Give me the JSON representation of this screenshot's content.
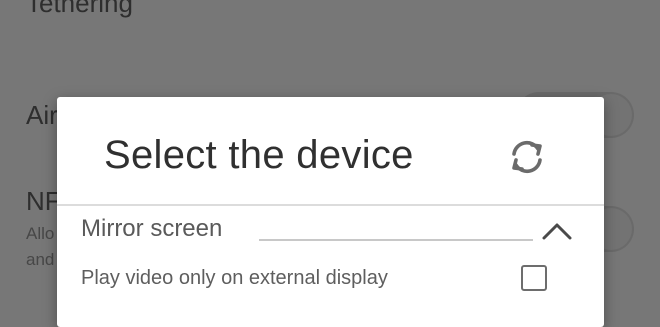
{
  "background": {
    "settings_items": [
      {
        "label": "Tethering"
      },
      {
        "label": "Air"
      },
      {
        "label": "NF",
        "subtitle_line1": "Allo",
        "subtitle_line2": "and"
      }
    ],
    "toggles": [
      {
        "name": "airplane-mode",
        "state": "off"
      },
      {
        "name": "nfc",
        "state": "off"
      }
    ]
  },
  "dialog": {
    "title": "Select the device",
    "refresh_icon": "refresh-icon",
    "section": {
      "title": "Mirror screen",
      "expanded": true,
      "chevron_icon": "chevron-up-icon"
    },
    "options": [
      {
        "label": "Play video only on external display",
        "checked": false
      }
    ]
  },
  "colors": {
    "scrim": "#777777",
    "dialog_bg": "#ffffff",
    "title_text": "#303030",
    "secondary_text": "#5a5a5a"
  }
}
